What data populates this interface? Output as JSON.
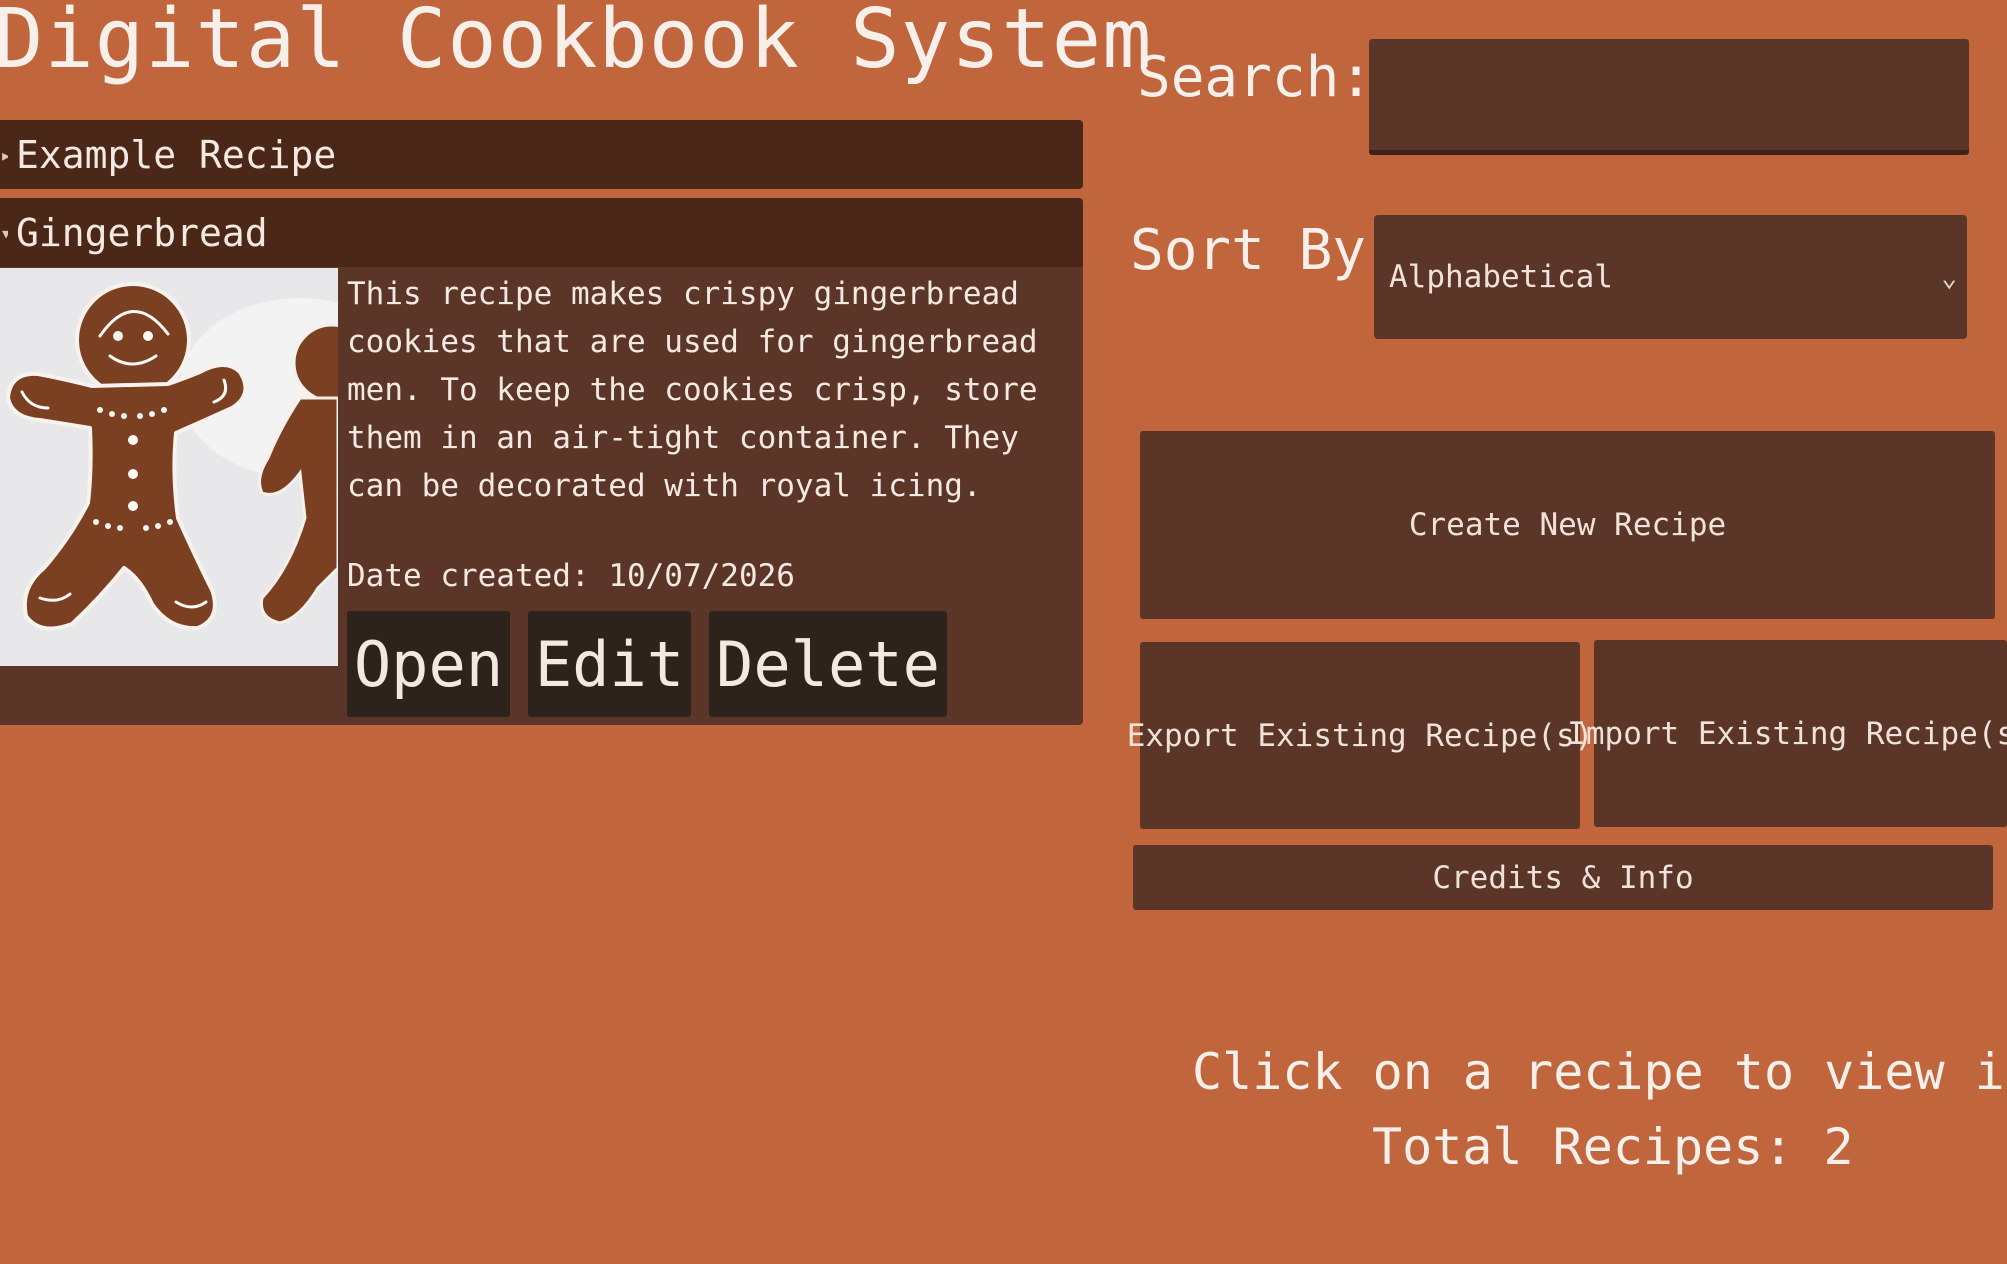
{
  "app": {
    "title": "Digital Cookbook System"
  },
  "recipes": [
    {
      "name": "Example Recipe",
      "expanded": false
    },
    {
      "name": "Gingerbread",
      "expanded": true,
      "description": "This recipe makes crispy gingerbread cookies that are used for gingerbread men. To keep the cookies crisp, store them in an air-tight container. They can be decorated with royal icing.",
      "date_label": "Date created:",
      "date_value": "10/07/2026",
      "actions": {
        "open": "Open",
        "edit": "Edit",
        "delete": "Delete"
      }
    }
  ],
  "search": {
    "label": "Search:",
    "value": ""
  },
  "sort": {
    "label": "Sort By:",
    "selected": "Alphabetical"
  },
  "panel": {
    "create": "Create New Recipe",
    "export": "Export Existing Recipe(s)",
    "import": "Import Existing Recipe(s)",
    "credits": "Credits & Info"
  },
  "status": {
    "hint": "Click on a recipe to view it.",
    "total_label": "Total Recipes:",
    "total_count": "2"
  },
  "icons": {
    "collapsed": "caret-right-icon",
    "expanded": "caret-down-icon",
    "dropdown": "chevron-down-icon"
  },
  "colors": {
    "background": "#c0653c",
    "header": "#4b2718",
    "panel": "#5b3628",
    "button_dark": "#2e221d",
    "text": "#f3e9e2"
  }
}
